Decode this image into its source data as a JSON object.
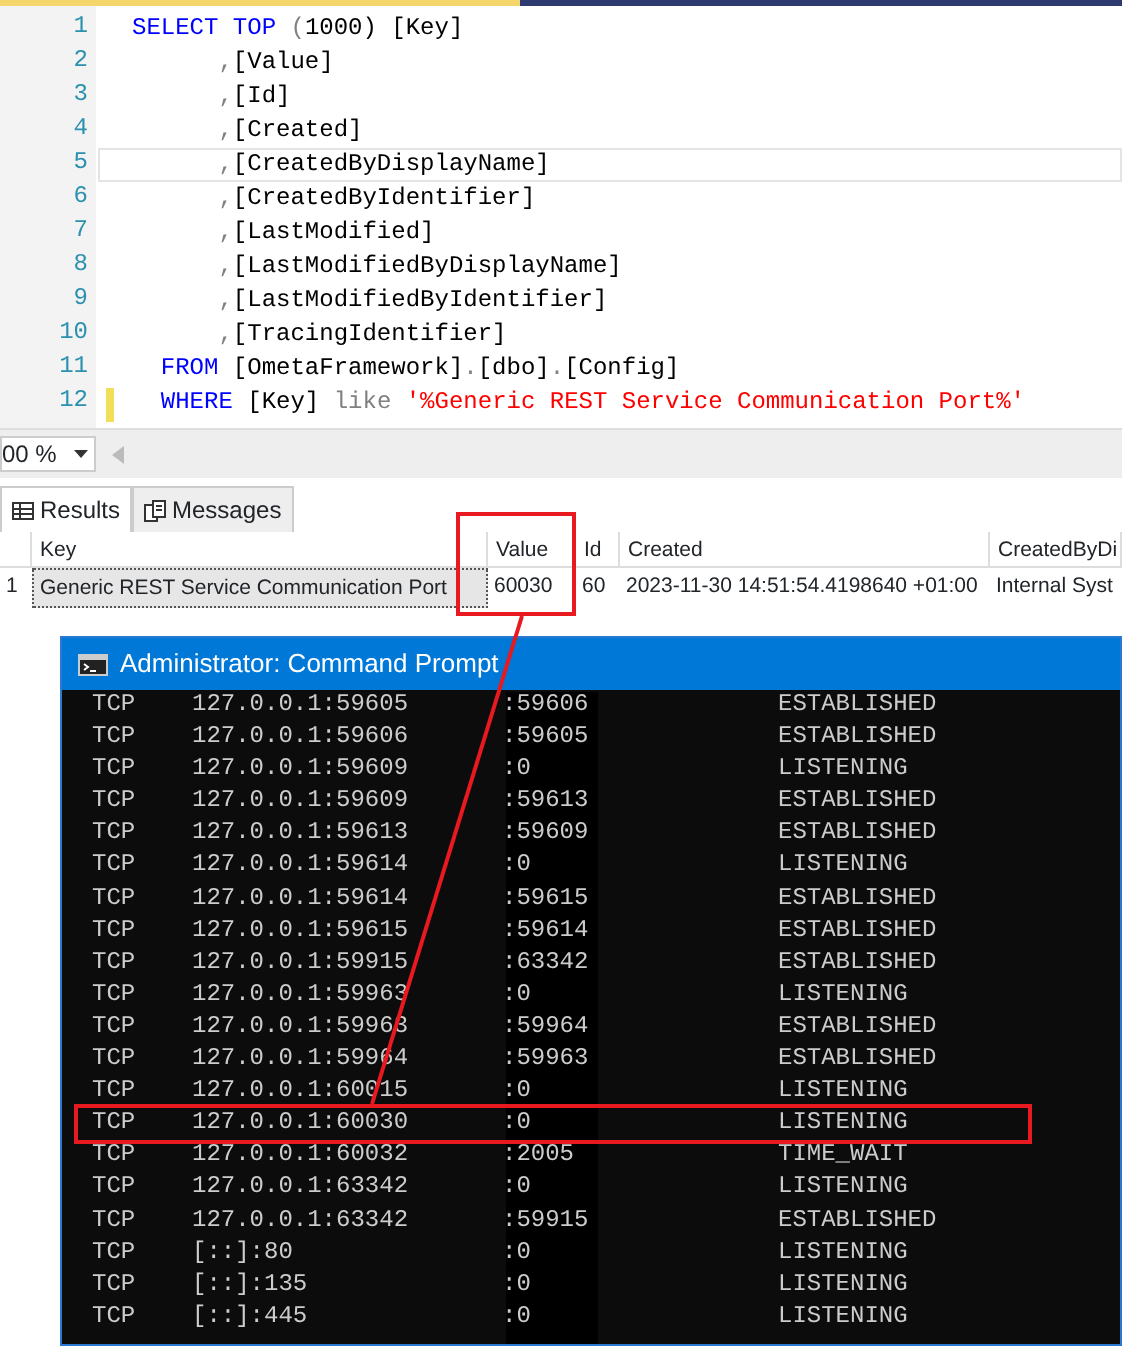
{
  "editor": {
    "lines": [
      {
        "number": "1",
        "current": false,
        "modified": false,
        "tokens": [
          {
            "text": "SELECT ",
            "kind": "keyword"
          },
          {
            "text": "TOP",
            "kind": "keyword"
          },
          {
            "text": " (",
            "kind": "punct"
          },
          {
            "text": "1000",
            "kind": "plain"
          },
          {
            "text": ") [Key]",
            "kind": "plain"
          }
        ]
      },
      {
        "number": "2",
        "current": false,
        "modified": false,
        "tokens": [
          {
            "text": "      ,",
            "kind": "punct"
          },
          {
            "text": "[Value]",
            "kind": "plain"
          }
        ]
      },
      {
        "number": "3",
        "current": false,
        "modified": false,
        "tokens": [
          {
            "text": "      ,",
            "kind": "punct"
          },
          {
            "text": "[Id]",
            "kind": "plain"
          }
        ]
      },
      {
        "number": "4",
        "current": false,
        "modified": false,
        "tokens": [
          {
            "text": "      ,",
            "kind": "punct"
          },
          {
            "text": "[Created]",
            "kind": "plain"
          }
        ]
      },
      {
        "number": "5",
        "current": true,
        "modified": false,
        "tokens": [
          {
            "text": "      ,",
            "kind": "punct"
          },
          {
            "text": "[CreatedByDisplayName]",
            "kind": "plain"
          }
        ]
      },
      {
        "number": "6",
        "current": false,
        "modified": false,
        "tokens": [
          {
            "text": "      ,",
            "kind": "punct"
          },
          {
            "text": "[CreatedByIdentifier]",
            "kind": "plain"
          }
        ]
      },
      {
        "number": "7",
        "current": false,
        "modified": false,
        "tokens": [
          {
            "text": "      ,",
            "kind": "punct"
          },
          {
            "text": "[LastModified]",
            "kind": "plain"
          }
        ]
      },
      {
        "number": "8",
        "current": false,
        "modified": false,
        "tokens": [
          {
            "text": "      ,",
            "kind": "punct"
          },
          {
            "text": "[LastModifiedByDisplayName]",
            "kind": "plain"
          }
        ]
      },
      {
        "number": "9",
        "current": false,
        "modified": false,
        "tokens": [
          {
            "text": "      ,",
            "kind": "punct"
          },
          {
            "text": "[LastModifiedByIdentifier]",
            "kind": "plain"
          }
        ]
      },
      {
        "number": "10",
        "current": false,
        "modified": false,
        "tokens": [
          {
            "text": "      ,",
            "kind": "punct"
          },
          {
            "text": "[TracingIdentifier]",
            "kind": "plain"
          }
        ]
      },
      {
        "number": "11",
        "current": false,
        "modified": false,
        "tokens": [
          {
            "text": "  FROM",
            "kind": "keyword"
          },
          {
            "text": " [OmetaFramework]",
            "kind": "plain"
          },
          {
            "text": ".",
            "kind": "punct"
          },
          {
            "text": "[dbo]",
            "kind": "plain"
          },
          {
            "text": ".",
            "kind": "punct"
          },
          {
            "text": "[Config]",
            "kind": "plain"
          }
        ]
      },
      {
        "number": "12",
        "current": false,
        "modified": true,
        "tokens": [
          {
            "text": "  WHERE",
            "kind": "keyword"
          },
          {
            "text": " [Key] ",
            "kind": "plain"
          },
          {
            "text": "like ",
            "kind": "operator"
          },
          {
            "text": "'%Generic REST Service Communication Port%'",
            "kind": "string"
          }
        ]
      }
    ]
  },
  "zoom": {
    "value": "00 %"
  },
  "result_tabs": [
    {
      "label": "Results",
      "selected": true
    },
    {
      "label": "Messages",
      "selected": false
    }
  ],
  "grid": {
    "columns": [
      "Key",
      "Value",
      "Id",
      "Created",
      "CreatedByDi"
    ],
    "rows": [
      {
        "number": "1",
        "cells": [
          "Generic REST Service Communication Port",
          "60030",
          "60",
          "2023-11-30 14:51:54.4198640 +01:00",
          "Internal Syst"
        ]
      }
    ]
  },
  "console": {
    "title": "Administrator: Command Prompt",
    "rows": [
      [
        "TCP",
        "127.0.0.1:59605",
        ":59606",
        "ESTABLISHED"
      ],
      [
        "TCP",
        "127.0.0.1:59606",
        ":59605",
        "ESTABLISHED"
      ],
      [
        "TCP",
        "127.0.0.1:59609",
        ":0",
        "LISTENING"
      ],
      [
        "TCP",
        "127.0.0.1:59609",
        ":59613",
        "ESTABLISHED"
      ],
      [
        "TCP",
        "127.0.0.1:59613",
        ":59609",
        "ESTABLISHED"
      ],
      [
        "TCP",
        "127.0.0.1:59614",
        ":0",
        "LISTENING"
      ],
      [
        "TCP",
        "127.0.0.1:59614",
        ":59615",
        "ESTABLISHED"
      ],
      [
        "TCP",
        "127.0.0.1:59615",
        ":59614",
        "ESTABLISHED"
      ],
      [
        "TCP",
        "127.0.0.1:59915",
        ":63342",
        "ESTABLISHED"
      ],
      [
        "TCP",
        "127.0.0.1:59963",
        ":0",
        "LISTENING"
      ],
      [
        "TCP",
        "127.0.0.1:59963",
        ":59964",
        "ESTABLISHED"
      ],
      [
        "TCP",
        "127.0.0.1:59964",
        ":59963",
        "ESTABLISHED"
      ],
      [
        "TCP",
        "127.0.0.1:60015",
        ":0",
        "LISTENING"
      ],
      [
        "TCP",
        "127.0.0.1:60030",
        ":0",
        "LISTENING"
      ],
      [
        "TCP",
        "127.0.0.1:60032",
        ":2005",
        "TIME_WAIT"
      ],
      [
        "TCP",
        "127.0.0.1:63342",
        ":0",
        "LISTENING"
      ],
      [
        "TCP",
        "127.0.0.1:63342",
        ":59915",
        "ESTABLISHED"
      ],
      [
        "TCP",
        "[::]:80",
        ":0",
        "LISTENING"
      ],
      [
        "TCP",
        "[::]:135",
        ":0",
        "LISTENING"
      ],
      [
        "TCP",
        "[::]:445",
        ":0",
        "LISTENING"
      ]
    ]
  },
  "callouts": [
    {
      "kind": "box"
    },
    {
      "kind": "line"
    },
    {
      "kind": "box"
    }
  ]
}
